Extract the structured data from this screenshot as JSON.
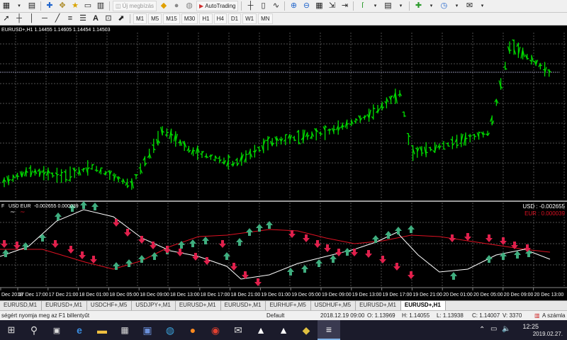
{
  "toolbar1": {
    "new_order_label": "Új megbízás",
    "autotrading_label": "AutoTrading"
  },
  "toolbar2": {
    "timeframes": [
      "M1",
      "M5",
      "M15",
      "M30",
      "H1",
      "H4",
      "D1",
      "W1",
      "MN"
    ]
  },
  "main_chart": {
    "header": "EURUSD+,H1  1.14455 1.14605 1.14454 1.14503",
    "bar_color": "#00dc00",
    "grid_color": "#6a6a6a",
    "hline_color": "#8a8aa6"
  },
  "indicator": {
    "name_label": "F",
    "pair_label": "USD EUR",
    "values_label": "-0.002655 0.000039",
    "usd_label": "USD : -0.002655",
    "eur_label": "EUR : 0.000039",
    "usd_color": "#ffffff",
    "eur_color": "#dd1122",
    "up_arrow_color": "#3fae7f",
    "down_arrow_color": "#e0204c"
  },
  "time_axis": [
    "Dec 2018",
    "17 Dec 17:00",
    "17 Dec 21:00",
    "18 Dec 01:00",
    "18 Dec 05:00",
    "18 Dec 09:00",
    "18 Dec 13:00",
    "18 Dec 17:00",
    "18 Dec 21:00",
    "19 Dec 01:00",
    "19 Dec 05:00",
    "19 Dec 09:00",
    "19 Dec 13:00",
    "19 Dec 17:00",
    "19 Dec 21:00",
    "20 Dec 01:00",
    "20 Dec 05:00",
    "20 Dec 09:00",
    "20 Dec 13:00"
  ],
  "tabs": [
    "EURUSD,M1",
    "EURUSD+,M1",
    "USDCHF+,M5",
    "USDJPY+,M1",
    "EURUSD+,M1",
    "EURUSD+,M1",
    "EURHUF+,M5",
    "USDHUF+,M5",
    "EURUSD+,M1",
    "EURUSD+,H1"
  ],
  "active_tab_index": 9,
  "status": {
    "help_text": "ségért nyomja meg az F1 billentyűt",
    "profile": "Default",
    "datetime": "2018.12.19 09:00",
    "open": "O: 1.13969",
    "high": "H: 1.14055",
    "low": "L: 1.13938",
    "close": "C: 1.14007",
    "volume": "V: 3370",
    "account": "A számla"
  },
  "taskbar": {
    "time": "12:25",
    "date": "2019.02.27."
  }
}
